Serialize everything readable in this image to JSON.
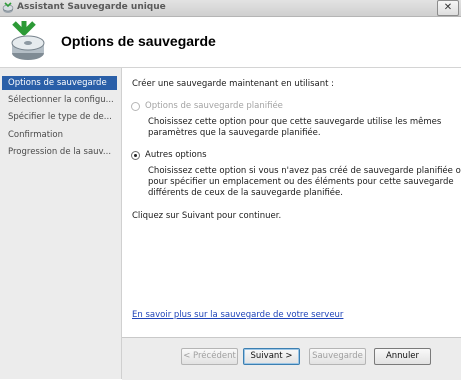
{
  "window": {
    "title": "Assistant Sauvegarde unique",
    "close_glyph": "✕"
  },
  "header": {
    "title": "Options de sauvegarde",
    "icon": "backup-disk-icon"
  },
  "sidebar": {
    "items": [
      {
        "label": "Options de sauvegarde",
        "active": true
      },
      {
        "label": "Sélectionner la configu..."
      },
      {
        "label": "Spécifier le type de de..."
      },
      {
        "label": "Confirmation"
      },
      {
        "label": "Progression de la sauv..."
      }
    ]
  },
  "main": {
    "intro": "Créer une sauvegarde maintenant en utilisant :",
    "option_scheduled": {
      "label": "Options de sauvegarde planifiée",
      "desc_line1": "Choisissez cette option pour que cette sauvegarde utilise les mêmes",
      "desc_line2": "paramètres que la sauvegarde planifiée.",
      "enabled": false,
      "selected": false
    },
    "option_other": {
      "label": "Autres options",
      "desc_line1": "Choisissez cette option si vous n'avez pas créé de sauvegarde planifiée ou",
      "desc_line2": "pour spécifier un emplacement ou des éléments pour cette sauvegarde",
      "desc_line3": "différents de ceux de la sauvegarde planifiée.",
      "enabled": true,
      "selected": true
    },
    "continue_text": "Cliquez sur Suivant pour continuer.",
    "learn_more_link": "En savoir plus sur la sauvegarde de votre serveur"
  },
  "footer": {
    "previous": "< Précédent",
    "next": "Suivant >",
    "backup": "Sauvegarde",
    "cancel": "Annuler"
  }
}
